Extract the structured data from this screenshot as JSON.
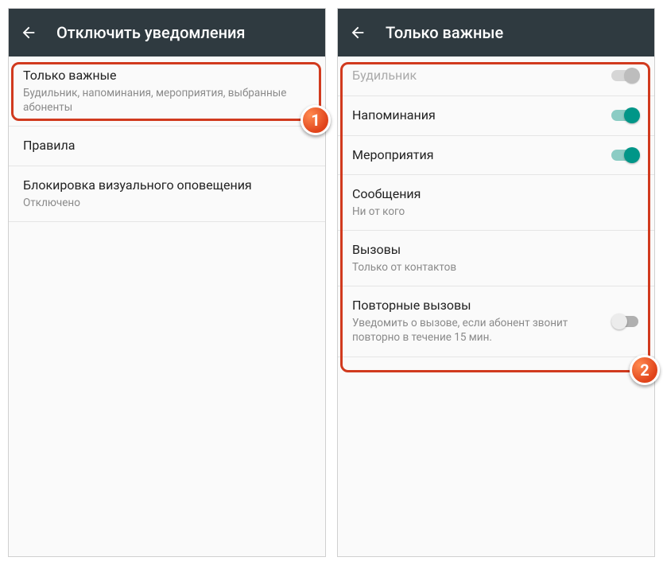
{
  "left": {
    "title": "Отключить уведомления",
    "items": {
      "priority": {
        "label": "Только важные",
        "summary": "Будильник, напоминания, мероприятия, выбранные абоненты"
      },
      "rules": {
        "label": "Правила"
      },
      "visual": {
        "label": "Блокировка визуального оповещения",
        "summary": "Отключено"
      }
    }
  },
  "right": {
    "title": "Только важные",
    "items": {
      "alarm": {
        "label": "Будильник"
      },
      "reminders": {
        "label": "Напоминания"
      },
      "events": {
        "label": "Мероприятия"
      },
      "messages": {
        "label": "Сообщения",
        "summary": "Ни от кого"
      },
      "calls": {
        "label": "Вызовы",
        "summary": "Только от контактов"
      },
      "repeat": {
        "label": "Повторные вызовы",
        "summary": "Уведомить о вызове, если абонент звонит повторно в течение 15 мин."
      }
    }
  },
  "badges": {
    "one": "1",
    "two": "2"
  }
}
